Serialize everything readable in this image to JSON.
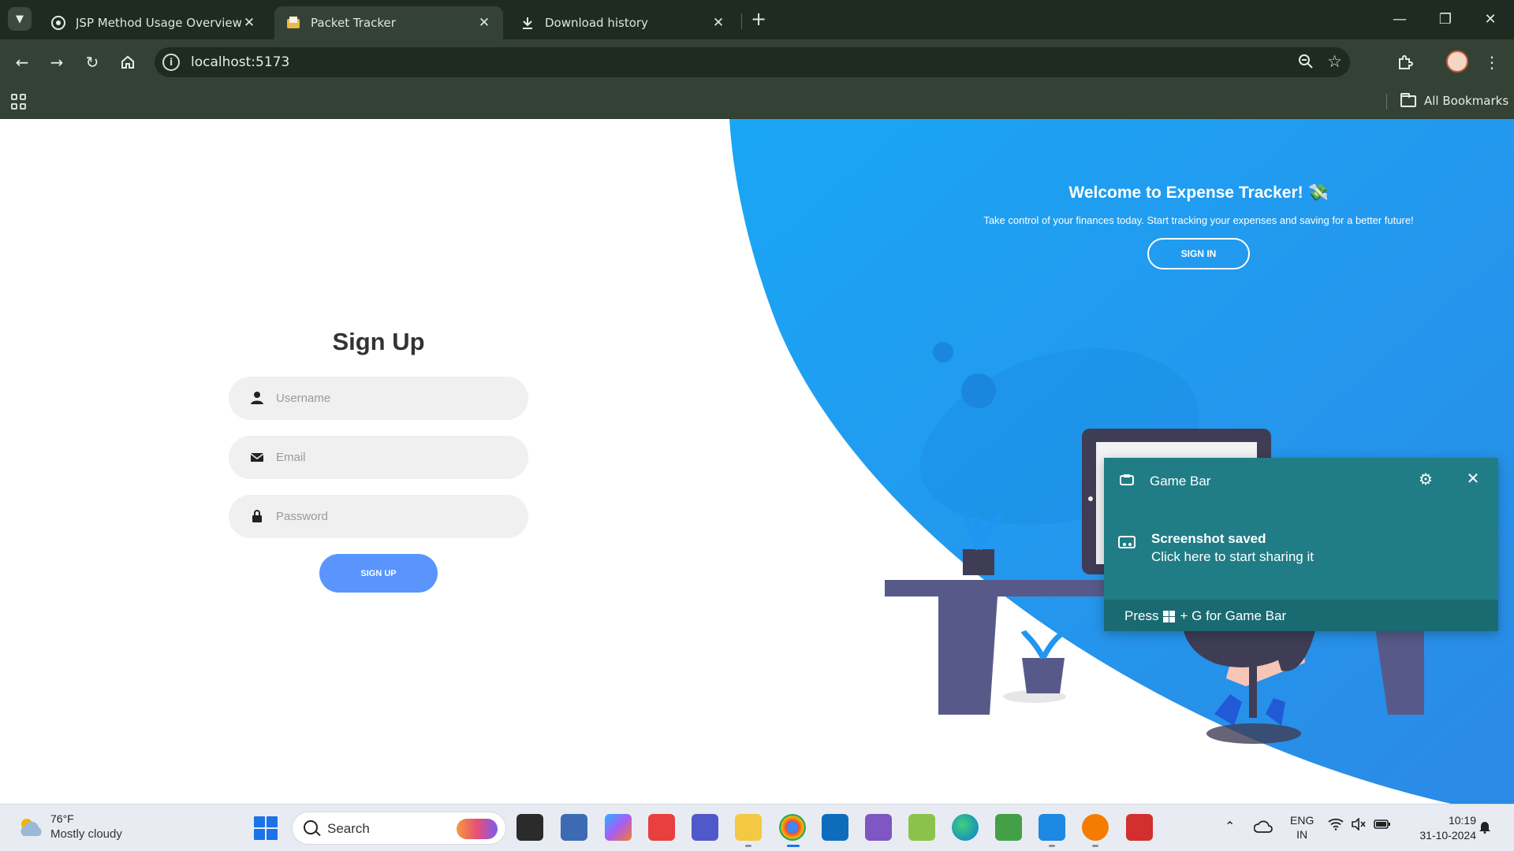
{
  "browser": {
    "tabs": [
      {
        "title": "JSP Method Usage Overview",
        "icon": "openai-icon",
        "active": false
      },
      {
        "title": "Packet Tracker",
        "icon": "folder-doc-icon",
        "active": true
      },
      {
        "title": "Download history",
        "icon": "download-icon",
        "active": false
      }
    ],
    "url": "localhost:5173",
    "bookmarks_label": "All Bookmarks"
  },
  "panel": {
    "welcome_title": "Welcome to Expense Tracker! 💸",
    "welcome_subtitle": "Take control of your finances today. Start tracking your expenses and saving for a better future!",
    "signin_label": "SIGN IN",
    "accent_color": "#1f96f1"
  },
  "form": {
    "title": "Sign Up",
    "username_placeholder": "Username",
    "email_placeholder": "Email",
    "password_placeholder": "Password",
    "submit_label": "SIGN UP",
    "button_color": "#5995fd"
  },
  "gamebar": {
    "title": "Game Bar",
    "message_title": "Screenshot saved",
    "message_body": "Click here to start sharing it",
    "footer_prefix": "Press",
    "footer_suffix": "+ G for Game Bar"
  },
  "taskbar": {
    "weather_temp": "76°F",
    "weather_desc": "Mostly cloudy",
    "search_label": "Search",
    "lang_top": "ENG",
    "lang_bottom": "IN",
    "time": "10:19",
    "date": "31-10-2024"
  }
}
